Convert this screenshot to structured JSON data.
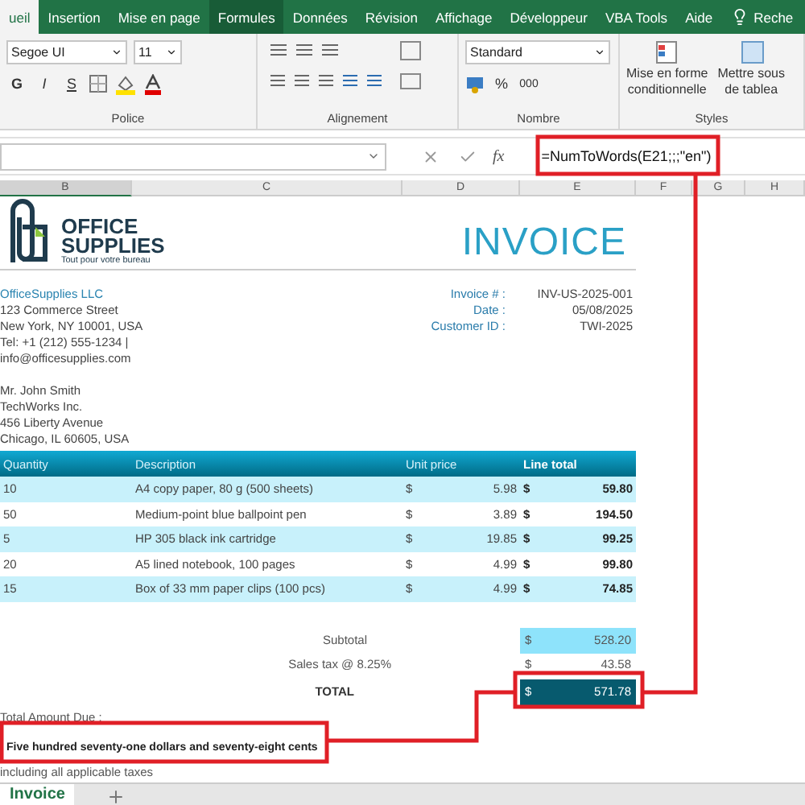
{
  "ribbon_tabs": [
    {
      "label": "ueil",
      "selected": true,
      "highlighted": false
    },
    {
      "label": "Insertion",
      "selected": false,
      "highlighted": false
    },
    {
      "label": "Mise en page",
      "selected": false,
      "highlighted": false
    },
    {
      "label": "Formules",
      "selected": false,
      "highlighted": true
    },
    {
      "label": "Données",
      "selected": false,
      "highlighted": false
    },
    {
      "label": "Révision",
      "selected": false,
      "highlighted": false
    },
    {
      "label": "Affichage",
      "selected": false,
      "highlighted": false
    },
    {
      "label": "Développeur",
      "selected": false,
      "highlighted": false
    },
    {
      "label": "VBA Tools",
      "selected": false,
      "highlighted": false
    },
    {
      "label": "Aide",
      "selected": false,
      "highlighted": false
    }
  ],
  "search_hint": "Reche",
  "ribbon": {
    "font": "Segoe UI",
    "size": "11",
    "style_buttons": [
      "G",
      "I",
      "S"
    ],
    "number_format": "Standard",
    "percent": "%",
    "thousands": "000",
    "conditional_format": [
      "Mise en forme",
      "conditionnelle"
    ],
    "table_format": [
      "Mettre sous",
      "de tablea"
    ],
    "groups": [
      "Police",
      "Alignement",
      "Nombre",
      "Styles"
    ]
  },
  "formula_bar": {
    "function_label": "fx",
    "formula": "=NumToWords(E21;;;\"en\")"
  },
  "columns": [
    {
      "label": "B",
      "selected": true
    },
    {
      "label": "C",
      "selected": false
    },
    {
      "label": "D",
      "selected": false
    },
    {
      "label": "E",
      "selected": false
    },
    {
      "label": "F",
      "selected": false
    },
    {
      "label": "G",
      "selected": false
    },
    {
      "label": "H",
      "selected": false
    }
  ],
  "invoice": {
    "logo": {
      "line1": "OFFICE",
      "line2": "SUPPLIES",
      "tagline": "Tout pour votre bureau"
    },
    "title": "INVOICE",
    "seller": [
      "OfficeSupplies LLC",
      "123 Commerce Street",
      "New York, NY 10001, USA",
      "Tel: +1 (212) 555-1234 |",
      "info@officesupplies.com"
    ],
    "buyer": [
      "Mr. John Smith",
      "TechWorks Inc.",
      "456 Liberty Avenue",
      "Chicago, IL 60605, USA"
    ],
    "meta": [
      {
        "label": "Invoice # :",
        "value": "INV-US-2025-001"
      },
      {
        "label": "Date :",
        "value": "05/08/2025"
      },
      {
        "label": "Customer ID :",
        "value": "TWI-2025"
      }
    ],
    "table_columns": [
      "Quantity",
      "Description",
      "Unit price",
      "Line total"
    ],
    "rows": [
      {
        "qty": "10",
        "description": "A4 copy paper, 80 g (500 sheets)",
        "cur": "$",
        "price": "5.98",
        "cur2": "$",
        "total": "59.80"
      },
      {
        "qty": "50",
        "description": "Medium-point blue ballpoint pen",
        "cur": "$",
        "price": "3.89",
        "cur2": "$",
        "total": "194.50"
      },
      {
        "qty": "5",
        "description": "HP 305 black ink cartridge",
        "cur": "$",
        "price": "19.85",
        "cur2": "$",
        "total": "99.25"
      },
      {
        "qty": "20",
        "description": "A5 lined notebook, 100 pages",
        "cur": "$",
        "price": "4.99",
        "cur2": "$",
        "total": "99.80"
      },
      {
        "qty": "15",
        "description": "Box of 33 mm paper clips (100 pcs)",
        "cur": "$",
        "price": "4.99",
        "cur2": "$",
        "total": "74.85"
      }
    ],
    "totals": [
      {
        "kind": "subtotal",
        "label": "Subtotal",
        "cur": "$",
        "value": "528.20"
      },
      {
        "kind": "tax",
        "label": "Sales tax @ 8.25%",
        "cur": "$",
        "value": "43.58"
      },
      {
        "kind": "total",
        "label": "TOTAL",
        "cur": "$",
        "value": "571.78"
      }
    ],
    "amount_due_label": "Total Amount Due :",
    "amount_words": "Five hundred seventy-one dollars and seventy-eight cents",
    "note": "including all applicable taxes"
  },
  "sheet_tabs": [
    {
      "label": "Invoice",
      "selected": true
    }
  ]
}
